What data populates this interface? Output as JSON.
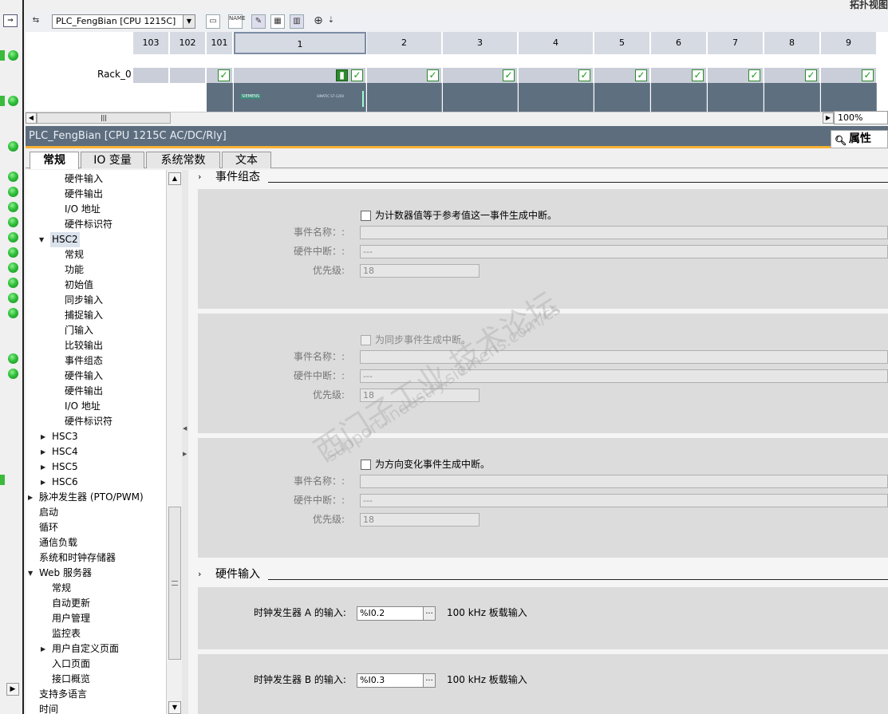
{
  "top_view_label": "拓扑视图",
  "device_selector": {
    "value": "PLC_FengBian [CPU 1215C]"
  },
  "toolbar": {
    "name_icon_text": "NAME"
  },
  "rack": {
    "label": "Rack_0",
    "slots": [
      "103",
      "102",
      "101",
      "1",
      "2",
      "3",
      "4",
      "5",
      "6",
      "7",
      "8",
      "9"
    ],
    "module_brand": "SIEMENS",
    "module_model": "SIMATIC S7-1200"
  },
  "zoom": "100%",
  "properties": {
    "title": "PLC_FengBian [CPU 1215C AC/DC/Rly]",
    "tab_label": "属性"
  },
  "tabs": [
    "常规",
    "IO 变量",
    "系统常数",
    "文本"
  ],
  "nav": {
    "items": [
      {
        "label": "硬件输入"
      },
      {
        "label": "硬件输出"
      },
      {
        "label": "I/O 地址"
      },
      {
        "label": "硬件标识符"
      },
      {
        "label": "HSC2"
      },
      {
        "label": "常规"
      },
      {
        "label": "功能"
      },
      {
        "label": "初始值"
      },
      {
        "label": "同步输入"
      },
      {
        "label": "捕捉输入"
      },
      {
        "label": "门输入"
      },
      {
        "label": "比较输出"
      },
      {
        "label": "事件组态"
      },
      {
        "label": "硬件输入"
      },
      {
        "label": "硬件输出"
      },
      {
        "label": "I/O 地址"
      },
      {
        "label": "硬件标识符"
      },
      {
        "label": "HSC3"
      },
      {
        "label": "HSC4"
      },
      {
        "label": "HSC5"
      },
      {
        "label": "HSC6"
      },
      {
        "label": "脉冲发生器 (PTO/PWM)"
      },
      {
        "label": "启动"
      },
      {
        "label": "循环"
      },
      {
        "label": "通信负载"
      },
      {
        "label": "系统和时钟存储器"
      },
      {
        "label": "Web 服务器"
      },
      {
        "label": "常规"
      },
      {
        "label": "自动更新"
      },
      {
        "label": "用户管理"
      },
      {
        "label": "监控表"
      },
      {
        "label": "用户自定义页面"
      },
      {
        "label": "入口页面"
      },
      {
        "label": "接口概览"
      },
      {
        "label": "支持多语言"
      },
      {
        "label": "时间"
      }
    ]
  },
  "content": {
    "event_section": {
      "title": "事件组态",
      "groups": [
        {
          "checkbox": "为计数器值等于参考值这一事件生成中断。",
          "name_label": "事件名称：:",
          "name_value": "",
          "hw_label": "硬件中断：:",
          "hw_value": "---",
          "prio_label": "优先级:",
          "prio_value": "18"
        },
        {
          "checkbox": "为同步事件生成中断。",
          "name_label": "事件名称：:",
          "name_value": "",
          "hw_label": "硬件中断：:",
          "hw_value": "---",
          "prio_label": "优先级:",
          "prio_value": "18"
        },
        {
          "checkbox": "为方向变化事件生成中断。",
          "name_label": "事件名称：:",
          "name_value": "",
          "hw_label": "硬件中断：:",
          "hw_value": "---",
          "prio_label": "优先级:",
          "prio_value": "18"
        }
      ]
    },
    "hw_section": {
      "title": "硬件输入",
      "rows": [
        {
          "label": "时钟发生器 A 的输入:",
          "value": "%I0.2",
          "button": "...",
          "desc": "100 kHz 板载输入"
        },
        {
          "label": "时钟发生器 B 的输入:",
          "value": "%I0.3",
          "button": "...",
          "desc": "100 kHz 板载输入"
        }
      ]
    }
  },
  "watermark": {
    "line1": "西门子工业 技术论坛",
    "line2": "support.industry.siemens.com/cs"
  },
  "colors": {
    "accent": "#f7b234",
    "title_bar": "#5d6d7e",
    "ok_green": "#2fbf3a"
  }
}
